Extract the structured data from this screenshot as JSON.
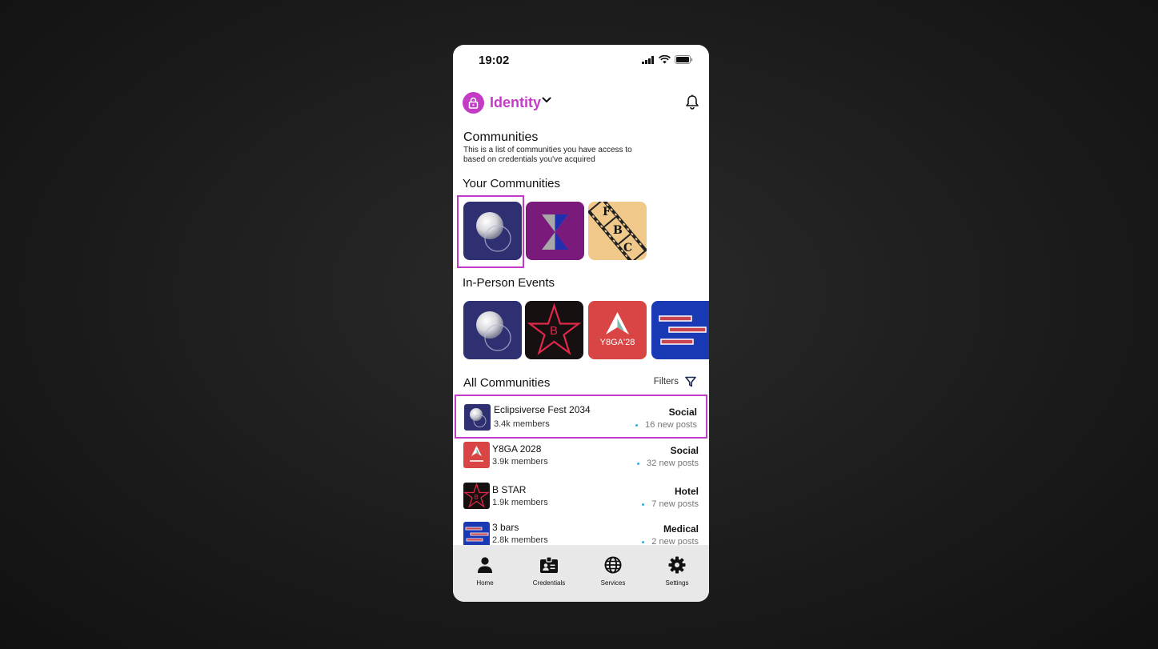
{
  "status": {
    "time": "19:02"
  },
  "header": {
    "app_name": "Identity"
  },
  "intro": {
    "title": "Communities",
    "description": "This is a list of communities you have access to based on credentials you've acquired"
  },
  "your_communities": {
    "heading": "Your Communities",
    "items": [
      {
        "name": "Eclipsiverse",
        "icon": "eclipse-logo",
        "selected": true
      },
      {
        "name": "Hourglass",
        "icon": "hourglass-logo"
      },
      {
        "name": "FBC",
        "icon": "film-strip-logo",
        "letters": [
          "F",
          "B",
          "C"
        ]
      }
    ]
  },
  "events": {
    "heading": "In-Person Events",
    "items": [
      {
        "icon": "eclipse-logo"
      },
      {
        "icon": "star-logo",
        "letter": "B"
      },
      {
        "icon": "y8ga-logo",
        "text": "Y8GA'28"
      },
      {
        "icon": "bars-logo"
      }
    ]
  },
  "all_communities": {
    "heading": "All Communities",
    "filters_label": "Filters",
    "rows": [
      {
        "name": "Eclipsiverse Fest 2034",
        "members": "3.4k members",
        "category": "Social",
        "posts": "16 new posts",
        "icon": "eclipse-logo",
        "selected": true
      },
      {
        "name": "Y8GA 2028",
        "members": "3.9k members",
        "category": "Social",
        "posts": "32 new posts",
        "icon": "y8ga-logo"
      },
      {
        "name": "B STAR",
        "members": "1.9k members",
        "category": "Hotel",
        "posts": "7 new posts",
        "icon": "star-logo"
      },
      {
        "name": "3 bars",
        "members": "2.8k members",
        "category": "Medical",
        "posts": "2 new posts",
        "icon": "bars-logo"
      }
    ]
  },
  "tabs": [
    {
      "label": "Home",
      "icon": "person-icon"
    },
    {
      "label": "Credentials",
      "icon": "id-badge-icon"
    },
    {
      "label": "Services",
      "icon": "globe-icon"
    },
    {
      "label": "Settings",
      "icon": "gear-icon"
    }
  ],
  "colors": {
    "accent": "#c43bc7",
    "eclipse_bg": "#2e3072",
    "hourglass_bg": "#7a1a7a",
    "film_bg": "#f0c98a",
    "star_bg": "#161010",
    "y8ga_bg": "#d94444",
    "bars_bg": "#1a3ab5",
    "tabbar_bg": "#e8e8e8"
  }
}
